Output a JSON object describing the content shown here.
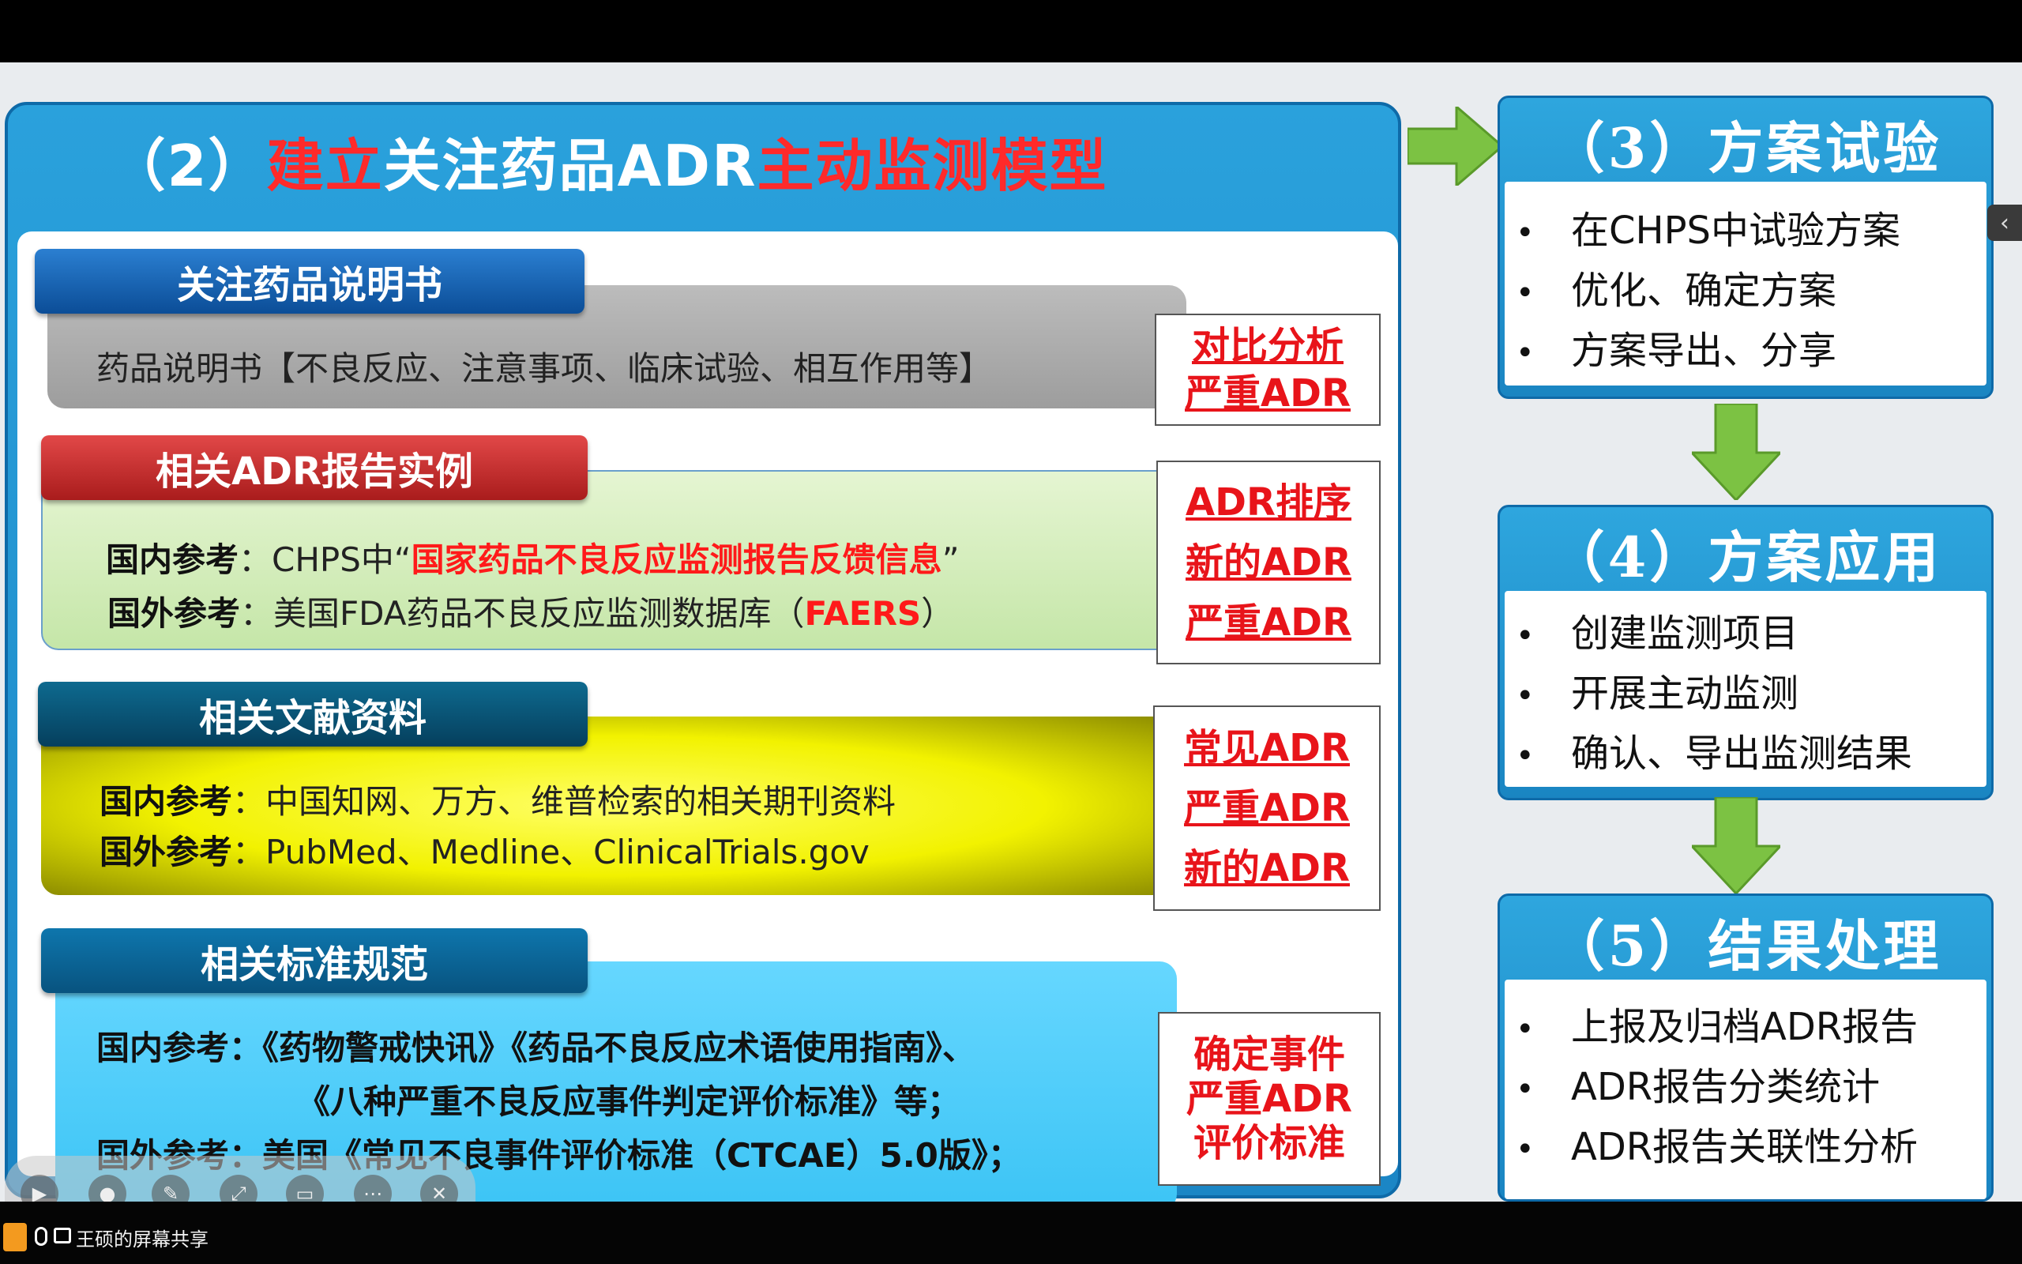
{
  "slide": {
    "main_title": {
      "prefix": "（2）",
      "red1": "建立",
      "mid": "关注药品ADR",
      "red2": "主动监测模型"
    },
    "sections": [
      {
        "tab": "关注药品说明书",
        "lines": [
          {
            "text": "药品说明书【不良反应、注意事项、临床试验、相互作用等】"
          }
        ],
        "tags": [
          "对比分析",
          "严重ADR"
        ]
      },
      {
        "tab": "相关ADR报告实例",
        "lines": [
          {
            "label": "国内参考",
            "pre": "：CHPS中“",
            "hl": "国家药品不良反应监测报告反馈信息",
            "post": "”"
          },
          {
            "label": "国外参考",
            "pre": "：美国FDA药品不良反应监测数据库（",
            "hl": "FAERS",
            "post": "）"
          }
        ],
        "tags": [
          "ADR排序",
          "新的ADR",
          "严重ADR"
        ]
      },
      {
        "tab": "相关文献资料",
        "lines": [
          {
            "label": "国内参考",
            "pre": "：中国知网、万方、维普检索的相关期刊资料"
          },
          {
            "label": "国外参考",
            "pre": "：PubMed、Medline、ClinicalTrials.gov"
          }
        ],
        "tags": [
          "常见ADR",
          "严重ADR",
          "新的ADR"
        ]
      },
      {
        "tab": "相关标准规范",
        "lines": [
          {
            "label": "国内参考：",
            "pre": "《药物警戒快讯》《药品不良反应术语使用指南》、"
          },
          {
            "label": "",
            "pre": "《八种严重不良反应事件判定评价标准》等；"
          },
          {
            "label": "国外参考",
            "pre": "：美国《常见不良事件评价标准（CTCAE）5.0版》；"
          }
        ],
        "tags": [
          "确定事件",
          "严重ADR",
          "评价标准"
        ]
      }
    ],
    "steps": [
      {
        "title": "（3）方案试验",
        "items": [
          "在CHPS中试验方案",
          "优化、确定方案",
          "方案导出、分享"
        ]
      },
      {
        "title": "（4）方案应用",
        "items": [
          "创建监测项目",
          "开展主动监测",
          "确认、导出监测结果"
        ]
      },
      {
        "title": "（5）结果处理",
        "items": [
          "上报及归档ADR报告",
          "ADR报告分类统计",
          "ADR报告关联性分析"
        ]
      }
    ],
    "bullet": "•",
    "colors": {
      "accent_blue": "#1b86c5",
      "highlight_red": "#e8141a",
      "arrow_green": "#7cc243"
    }
  },
  "meeting": {
    "side_handle": "‹",
    "share_label": "王硕的屏幕共享",
    "toolbar_icons": [
      "play-icon",
      "pointer-icon",
      "pen-icon",
      "fullscreen-icon",
      "screenshot-icon",
      "more-icon",
      "close-icon"
    ]
  }
}
